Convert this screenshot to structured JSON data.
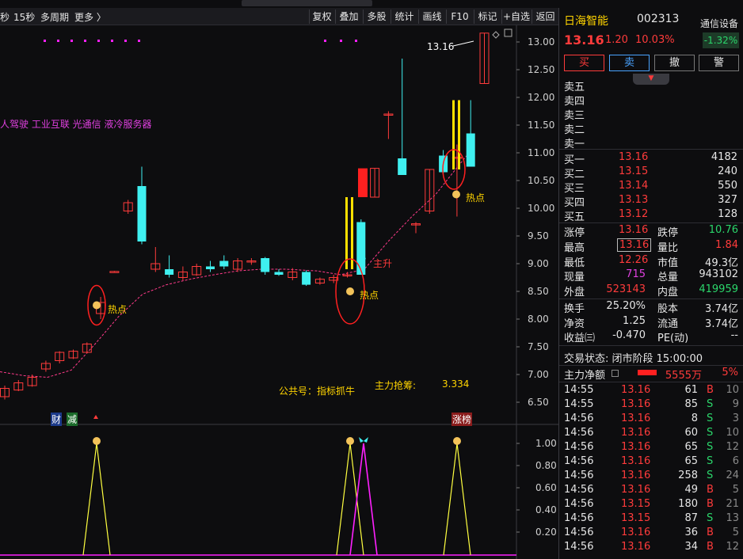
{
  "toolbar": {
    "left_items": [
      "秒",
      "15秒",
      "多周期",
      "更多 〉"
    ],
    "buttons": [
      "复权",
      "叠加",
      "多股",
      "统计",
      "画线",
      "F10",
      "标记",
      "+自选",
      "返回"
    ]
  },
  "chart": {
    "price_label": "13.16",
    "concepts": "人驾驶 工业互联 光通信 液冷服务器",
    "signal_hot": "热点",
    "signal_main": "主升",
    "footer_public": "公共号：指标抓牛",
    "footer_main_label": "主力抢筹:",
    "footer_main_value": "3.334",
    "event_tags": [
      "财",
      "减"
    ],
    "limit_tag": "涨榜",
    "y_ticks": [
      "13.00",
      "12.50",
      "12.00",
      "11.50",
      "11.00",
      "10.50",
      "10.00",
      "9.50",
      "9.00",
      "8.50",
      "8.00",
      "7.50",
      "7.00",
      "6.50"
    ],
    "sub_ticks": [
      "1.00",
      "0.80",
      "0.60",
      "0.40",
      "0.20"
    ],
    "colors": {
      "up": "#ff3b3b",
      "down": "#3ff0f0",
      "ma": "#ff3b8a",
      "signal": "#ffff40",
      "main": "#ff20ff"
    }
  },
  "chart_data": {
    "type": "candlestick",
    "ylim": [
      6.2,
      13.3
    ],
    "candles": [
      {
        "o": 6.6,
        "h": 6.8,
        "l": 6.55,
        "c": 6.75
      },
      {
        "o": 6.72,
        "h": 6.9,
        "l": 6.7,
        "c": 6.85
      },
      {
        "o": 6.8,
        "h": 7.0,
        "l": 6.78,
        "c": 6.95
      },
      {
        "o": 7.1,
        "h": 7.25,
        "l": 7.05,
        "c": 7.2
      },
      {
        "o": 7.25,
        "h": 7.42,
        "l": 7.2,
        "c": 7.4
      },
      {
        "o": 7.3,
        "h": 7.45,
        "l": 7.28,
        "c": 7.42
      },
      {
        "o": 7.4,
        "h": 7.58,
        "l": 7.38,
        "c": 7.55
      },
      {
        "o": 8.1,
        "h": 8.4,
        "l": 8.0,
        "c": 8.3
      },
      {
        "o": 8.85,
        "h": 8.87,
        "l": 8.85,
        "c": 8.86
      },
      {
        "o": 9.95,
        "h": 10.15,
        "l": 9.9,
        "c": 10.1
      },
      {
        "o": 10.4,
        "h": 10.75,
        "l": 9.35,
        "c": 9.4
      },
      {
        "o": 8.9,
        "h": 9.3,
        "l": 8.85,
        "c": 9.0
      },
      {
        "o": 8.9,
        "h": 9.15,
        "l": 8.75,
        "c": 8.8
      },
      {
        "o": 8.75,
        "h": 8.95,
        "l": 8.7,
        "c": 8.85
      },
      {
        "o": 8.8,
        "h": 9.0,
        "l": 8.78,
        "c": 8.95
      },
      {
        "o": 8.95,
        "h": 9.05,
        "l": 8.85,
        "c": 8.9
      },
      {
        "o": 9.05,
        "h": 9.15,
        "l": 8.9,
        "c": 8.95
      },
      {
        "o": 8.9,
        "h": 9.1,
        "l": 8.85,
        "c": 9.05
      },
      {
        "o": 9.05,
        "h": 9.1,
        "l": 8.98,
        "c": 9.05
      },
      {
        "o": 9.1,
        "h": 9.12,
        "l": 8.8,
        "c": 8.85
      },
      {
        "o": 8.85,
        "h": 8.9,
        "l": 8.78,
        "c": 8.8
      },
      {
        "o": 8.75,
        "h": 8.92,
        "l": 8.7,
        "c": 8.85
      },
      {
        "o": 8.85,
        "h": 8.88,
        "l": 8.6,
        "c": 8.62
      },
      {
        "o": 8.65,
        "h": 8.75,
        "l": 8.62,
        "c": 8.72
      },
      {
        "o": 8.7,
        "h": 8.8,
        "l": 8.65,
        "c": 8.75
      },
      {
        "o": 8.8,
        "h": 8.85,
        "l": 8.75,
        "c": 8.8
      },
      {
        "o": 9.75,
        "h": 9.8,
        "l": 8.85,
        "c": 8.8
      },
      {
        "o": 10.2,
        "h": 10.72,
        "l": 10.2,
        "c": 10.72
      },
      {
        "o": 11.7,
        "h": 11.75,
        "l": 11.25,
        "c": 11.7
      },
      {
        "o": 10.9,
        "h": 12.7,
        "l": 10.8,
        "c": 10.6
      },
      {
        "o": 9.7,
        "h": 9.75,
        "l": 9.55,
        "c": 9.72
      },
      {
        "o": 9.95,
        "h": 10.7,
        "l": 9.9,
        "c": 10.7
      },
      {
        "o": 10.95,
        "h": 11.05,
        "l": 10.6,
        "c": 10.65
      },
      {
        "o": 10.9,
        "h": 11.15,
        "l": 9.85,
        "c": 10.92
      },
      {
        "o": 11.35,
        "h": 11.95,
        "l": 10.75,
        "c": 10.75
      },
      {
        "o": 12.25,
        "h": 13.16,
        "l": 12.25,
        "c": 13.16
      }
    ],
    "signal_peaks_yellow": [
      1.0,
      1.0,
      1.0
    ],
    "signal_peaks_magenta": [
      1.0
    ]
  },
  "panel": {
    "name": "日海智能",
    "code": "002313",
    "price": "13.16",
    "change": "1.20",
    "pct": "10.03%",
    "sector": "通信设备",
    "sector_pct": "-1.32%",
    "buttons": {
      "buy": "买",
      "sell": "卖",
      "cancel": "撤",
      "alert": "警"
    },
    "expand_icon": "chevron-down",
    "asks": [
      {
        "label": "卖五",
        "price": "",
        "vol": ""
      },
      {
        "label": "卖四",
        "price": "",
        "vol": ""
      },
      {
        "label": "卖三",
        "price": "",
        "vol": ""
      },
      {
        "label": "卖二",
        "price": "",
        "vol": ""
      },
      {
        "label": "卖一",
        "price": "",
        "vol": ""
      }
    ],
    "bids": [
      {
        "label": "买一",
        "price": "13.16",
        "vol": "4182"
      },
      {
        "label": "买二",
        "price": "13.15",
        "vol": "240"
      },
      {
        "label": "买三",
        "price": "13.14",
        "vol": "550"
      },
      {
        "label": "买四",
        "price": "13.13",
        "vol": "327"
      },
      {
        "label": "买五",
        "price": "13.12",
        "vol": "128"
      }
    ],
    "stats": {
      "limit_up_label": "涨停",
      "limit_up": "13.16",
      "limit_down_label": "跌停",
      "limit_down": "10.76",
      "high_label": "最高",
      "high": "13.16",
      "vol_ratio_label": "量比",
      "vol_ratio": "1.84",
      "low_label": "最低",
      "low": "12.26",
      "mkt_cap_label": "市值",
      "mkt_cap": "49.3亿",
      "cur_vol_label": "现量",
      "cur_vol": "715",
      "total_vol_label": "总量",
      "total_vol": "943102",
      "outer_label": "外盘",
      "outer": "523143",
      "inner_label": "内盘",
      "inner": "419959",
      "turnover_label": "换手",
      "turnover": "25.20%",
      "shares_label": "股本",
      "shares": "3.74亿",
      "nav_label": "净资",
      "nav": "1.25",
      "float_label": "流通",
      "float": "3.74亿",
      "eps_label": "收益㈢",
      "eps": "-0.470",
      "pe_label": "PE(动)",
      "pe": "--"
    },
    "status": "交易状态: 闭市阶段 15:00:00",
    "net_flow_label": "主力净额",
    "net_flow_value": "5555万",
    "net_flow_pct": "5%",
    "ticks": [
      {
        "t": "14:55",
        "p": "13.16",
        "v": "61",
        "bs": "B",
        "n": "10"
      },
      {
        "t": "14:55",
        "p": "13.16",
        "v": "85",
        "bs": "S",
        "n": "9"
      },
      {
        "t": "14:56",
        "p": "13.16",
        "v": "8",
        "bs": "S",
        "n": "3"
      },
      {
        "t": "14:56",
        "p": "13.16",
        "v": "60",
        "bs": "S",
        "n": "10"
      },
      {
        "t": "14:56",
        "p": "13.16",
        "v": "65",
        "bs": "S",
        "n": "12"
      },
      {
        "t": "14:56",
        "p": "13.16",
        "v": "65",
        "bs": "S",
        "n": "6"
      },
      {
        "t": "14:56",
        "p": "13.16",
        "v": "258",
        "bs": "S",
        "n": "24"
      },
      {
        "t": "14:56",
        "p": "13.16",
        "v": "49",
        "bs": "B",
        "n": "5"
      },
      {
        "t": "14:56",
        "p": "13.15",
        "v": "180",
        "bs": "B",
        "n": "21"
      },
      {
        "t": "14:56",
        "p": "13.15",
        "v": "87",
        "bs": "S",
        "n": "13"
      },
      {
        "t": "14:56",
        "p": "13.16",
        "v": "36",
        "bs": "B",
        "n": "5"
      },
      {
        "t": "14:56",
        "p": "13.16",
        "v": "34",
        "bs": "B",
        "n": "12"
      }
    ]
  }
}
